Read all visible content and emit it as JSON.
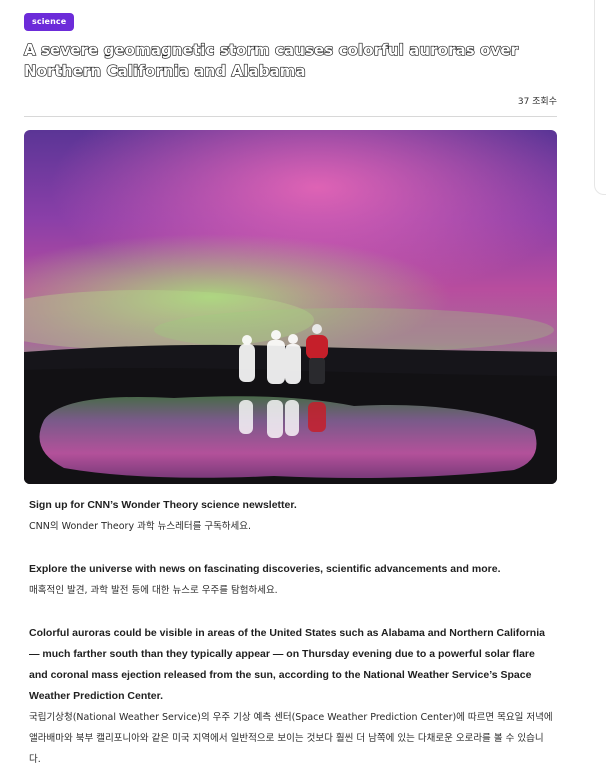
{
  "article": {
    "category_badge": "science",
    "title": "A severe geomagnetic storm causes colorful auroras over Northern California and Alabama",
    "view_count": "37 조회수",
    "hero_image": {
      "description_icon": "aurora-photo",
      "colors": {
        "sky_top": "#6a3aa0",
        "sky_pink": "#d85aa8",
        "aurora_green": "#8fd36a",
        "ground": "#1a1418",
        "reflection_pink": "#c24f9a",
        "jacket_red": "#c51f2a"
      }
    },
    "paragraphs": [
      {
        "en": "Sign up for CNN’s Wonder Theory science newsletter.",
        "ko": "CNN의 Wonder Theory 과학 뉴스레터를 구독하세요."
      },
      {
        "en": "Explore the universe with news on fascinating discoveries, scientific advancements and more.",
        "ko": "매혹적인 발견, 과학 발전 등에 대한 뉴스로 우주를 탐험하세요."
      },
      {
        "en": "Colorful auroras could be visible in areas of the United States such as Alabama and Northern California — much farther south than they typically appear — on Thursday evening due to a powerful solar flare and coronal mass ejection released from the sun, according to the National Weather Service’s Space Weather Prediction Center.",
        "ko": "국립기상청(National Weather Service)의 우주 기상 예측 센터(Space Weather Prediction Center)에 따르면 목요일 저녁에 앨라배마와 북부 캘리포니아와 같은 미국 지역에서 일반적으로 보이는 것보다 훨씬 더 남쪽에 있는 다채로운 오로라를 볼 수 있습니다."
      }
    ]
  }
}
